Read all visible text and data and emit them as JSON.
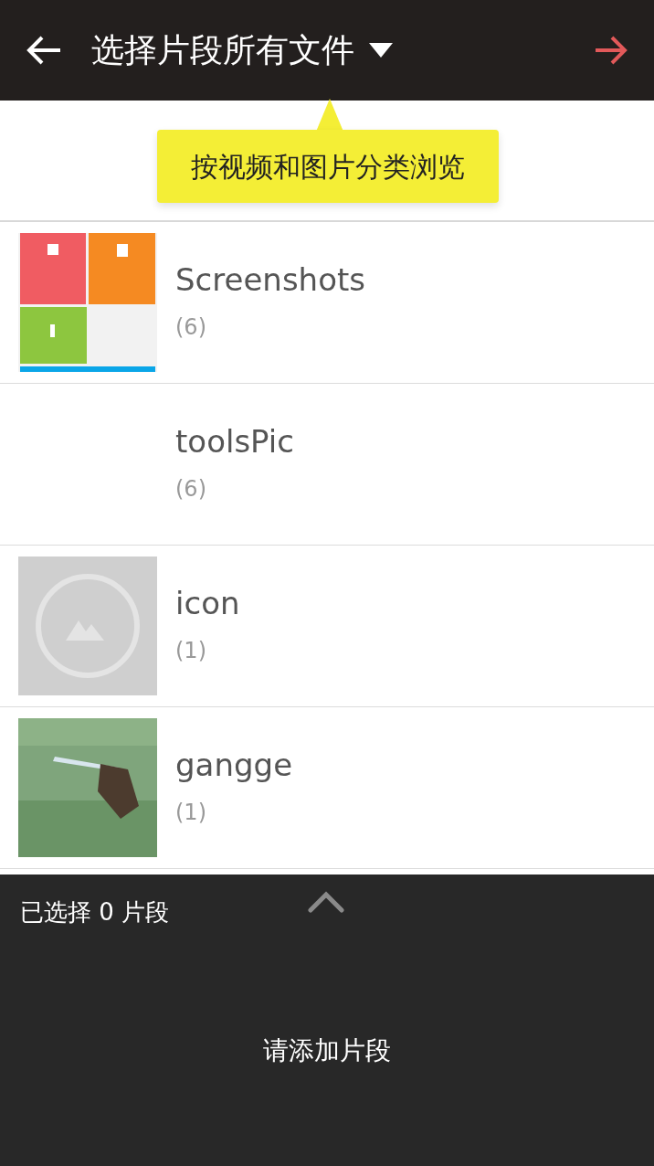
{
  "header": {
    "title": "选择片段所有文件"
  },
  "tooltip": {
    "text": "按视频和图片分类浏览"
  },
  "albums": [
    {
      "name": "Screenshots",
      "count": "(6)",
      "kind": "tiles"
    },
    {
      "name": "toolsPic",
      "count": "(6)",
      "kind": "none"
    },
    {
      "name": "icon",
      "count": "(1)",
      "kind": "placeholder"
    },
    {
      "name": "gangge",
      "count": "(1)"
    }
  ],
  "bottom_panel": {
    "selected_text": "已选择 0 片段",
    "empty_text": "请添加片段"
  }
}
